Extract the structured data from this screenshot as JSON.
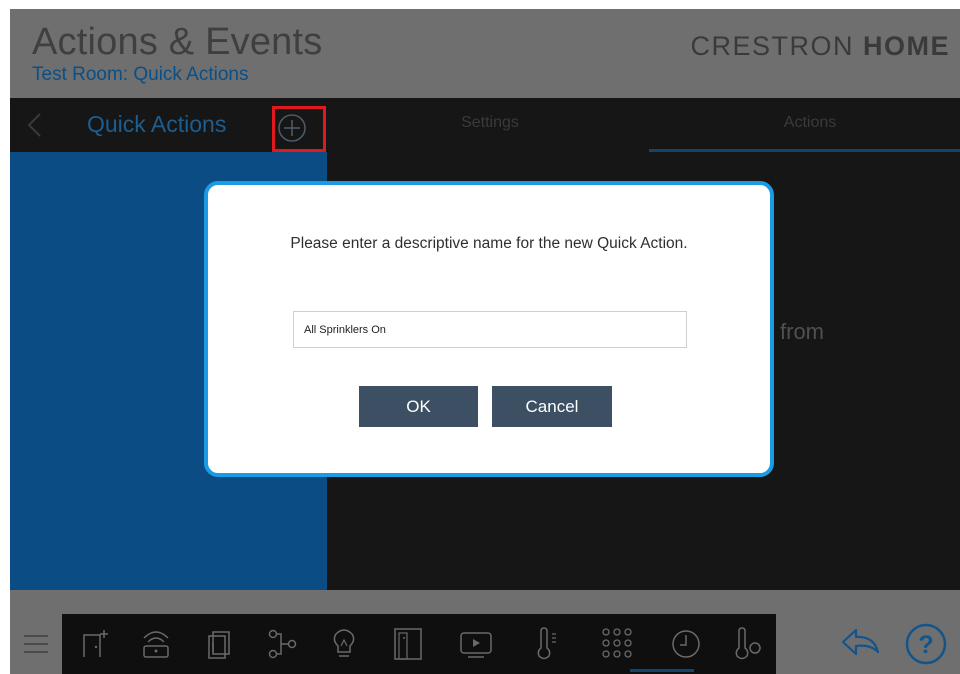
{
  "header": {
    "title": "Actions & Events",
    "subtitle": "Test Room: Quick Actions",
    "brand_light": "CRESTRON ",
    "brand_bold": "HOME"
  },
  "subbar": {
    "back_icon": "chevron-left-icon",
    "title": "Quick Actions",
    "add_icon": "plus-circle-icon",
    "tabs": [
      {
        "label": "Settings",
        "active": false
      },
      {
        "label": "Actions",
        "active": true
      }
    ]
  },
  "content": {
    "partial_text": "from"
  },
  "dialog": {
    "prompt": "Please enter a descriptive name for the new Quick Action.",
    "name_value": "All Sprinklers On",
    "ok_label": "OK",
    "cancel_label": "Cancel"
  },
  "bottom_nav": {
    "menu_icon": "hamburger-menu-icon",
    "items": [
      {
        "name": "add-room-icon",
        "active": false
      },
      {
        "name": "security-icon",
        "active": false
      },
      {
        "name": "shades-icon",
        "active": false
      },
      {
        "name": "scenes-icon",
        "active": false
      },
      {
        "name": "lightbulb-icon",
        "active": false
      },
      {
        "name": "door-icon",
        "active": false
      },
      {
        "name": "media-icon",
        "active": false
      },
      {
        "name": "climate-icon",
        "active": false
      },
      {
        "name": "keypad-icon",
        "active": true
      },
      {
        "name": "clock-icon",
        "active": false
      },
      {
        "name": "thermostat-icon",
        "active": false
      }
    ],
    "undo_icon": "undo-icon",
    "help_icon": "help-icon"
  },
  "colors": {
    "overlay_gray": "#6f6f6f",
    "dark": "#161616",
    "blue_panel": "#0a4c83",
    "modal_border": "#1a9be3",
    "button": "#3d4f62",
    "highlight": "#e0191e"
  }
}
